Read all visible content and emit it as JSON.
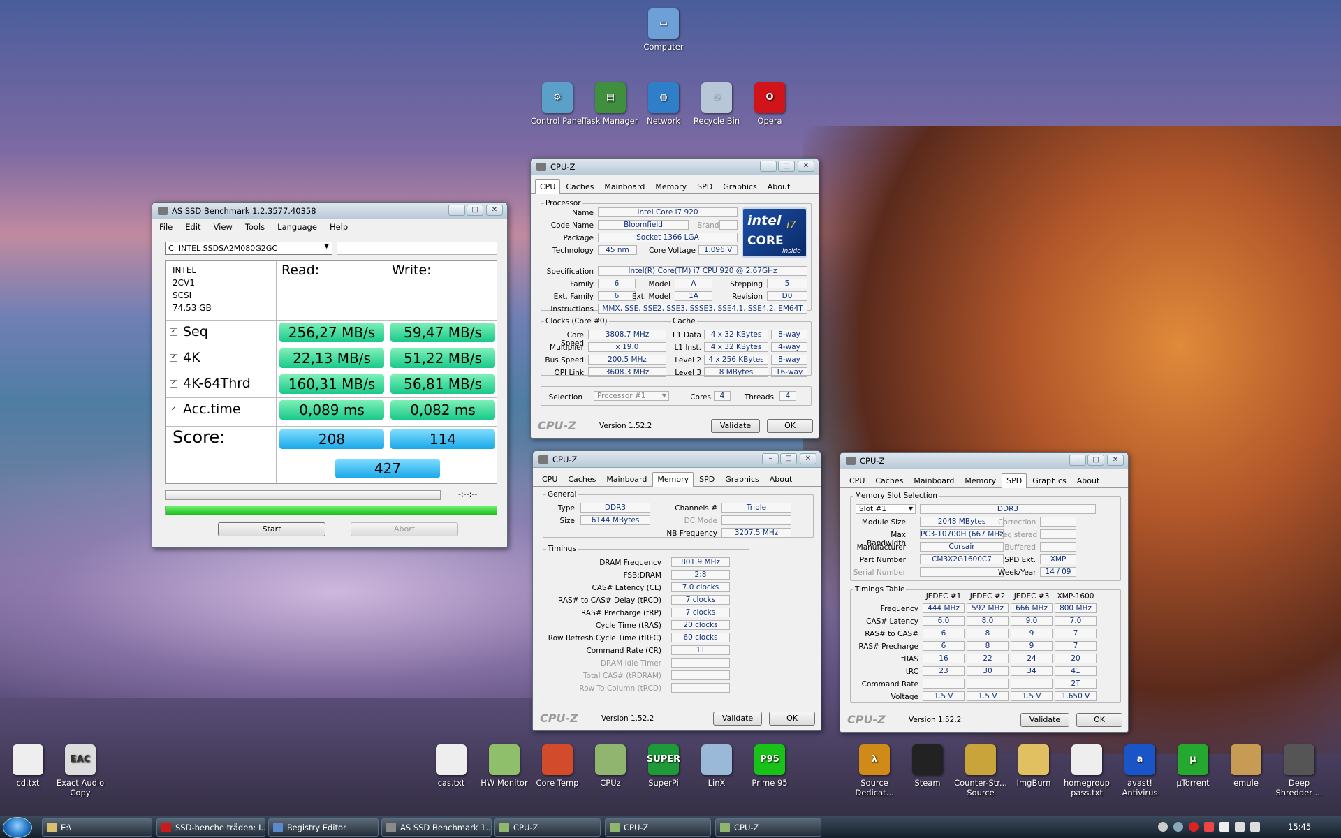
{
  "desktop": {
    "top_icons": [
      {
        "label": "Computer",
        "icon": "computer-icon"
      },
      {
        "label": "Control Panel",
        "icon": "control-panel-icon"
      },
      {
        "label": "Task Manager",
        "icon": "task-manager-icon"
      },
      {
        "label": "Network",
        "icon": "network-icon"
      },
      {
        "label": "Recycle Bin",
        "icon": "recycle-bin-icon"
      },
      {
        "label": "Opera",
        "icon": "opera-icon"
      }
    ],
    "bottom_icons": [
      {
        "label": "cd.txt",
        "color": "#eeeeee",
        "glyph": ""
      },
      {
        "label": "Exact Audio Copy",
        "color": "#dddddd",
        "glyph": "EAC"
      },
      {
        "label": "cas.txt",
        "color": "#eeeeee",
        "glyph": ""
      },
      {
        "label": "HW Monitor",
        "color": "#8fbf6a",
        "glyph": ""
      },
      {
        "label": "Core Temp",
        "color": "#d24c2b",
        "glyph": ""
      },
      {
        "label": "CPUz",
        "color": "#8fb56f",
        "glyph": ""
      },
      {
        "label": "SuperPi",
        "color": "#1f9a3a",
        "glyph": "SUPER"
      },
      {
        "label": "LinX",
        "color": "#9ab8d8",
        "glyph": ""
      },
      {
        "label": "Prime 95",
        "color": "#19c219",
        "glyph": "P95"
      },
      {
        "label": "Source Dedicat...",
        "color": "#d08a18",
        "glyph": "λ"
      },
      {
        "label": "Steam",
        "color": "#222222",
        "glyph": ""
      },
      {
        "label": "Counter-Str... Source",
        "color": "#c8a43a",
        "glyph": ""
      },
      {
        "label": "ImgBurn",
        "color": "#e0c060",
        "glyph": ""
      },
      {
        "label": "homegroup pass.txt",
        "color": "#eeeeee",
        "glyph": ""
      },
      {
        "label": "avast! Antivirus",
        "color": "#1a55c8",
        "glyph": "a"
      },
      {
        "label": "µTorrent",
        "color": "#24a830",
        "glyph": "µ"
      },
      {
        "label": "emule",
        "color": "#c89b55",
        "glyph": ""
      },
      {
        "label": "Deep Shredder ...",
        "color": "#555555",
        "glyph": ""
      }
    ]
  },
  "asssd": {
    "title": "AS SSD Benchmark 1.2.3577.40358",
    "menu": [
      "File",
      "Edit",
      "View",
      "Tools",
      "Language",
      "Help"
    ],
    "drive_select": "C: INTEL SSDSA2M080G2GC",
    "info": [
      "INTEL",
      "2CV1",
      "SCSI",
      "74,53 GB"
    ],
    "read_header": "Read:",
    "write_header": "Write:",
    "rows": [
      {
        "label": "Seq",
        "read": "256,27 MB/s",
        "write": "59,47 MB/s"
      },
      {
        "label": "4K",
        "read": "22,13 MB/s",
        "write": "51,22 MB/s"
      },
      {
        "label": "4K-64Thrd",
        "read": "160,31 MB/s",
        "write": "56,81 MB/s"
      },
      {
        "label": "Acc.time",
        "read": "0,089 ms",
        "write": "0,082 ms"
      }
    ],
    "score_label": "Score:",
    "score_read": "208",
    "score_write": "114",
    "score_total": "427",
    "progress_time": "-:--:--",
    "progress_fraction": 1.0,
    "start_label": "Start",
    "abort_label": "Abort"
  },
  "cpuz_common": {
    "title": "CPU-Z",
    "tabs": [
      "CPU",
      "Caches",
      "Mainboard",
      "Memory",
      "SPD",
      "Graphics",
      "About"
    ],
    "logo": "CPU-Z",
    "version": "Version 1.52.2",
    "validate": "Validate",
    "ok": "OK"
  },
  "cpu": {
    "processor_legend": "Processor",
    "name_l": "Name",
    "name": "Intel Core i7 920",
    "codename_l": "Code Name",
    "codename": "Bloomfield",
    "brandid_l": "Brand ID",
    "package_l": "Package",
    "package": "Socket 1366 LGA",
    "tech_l": "Technology",
    "tech": "45 nm",
    "voltage_l": "Core Voltage",
    "voltage": "1.096 V",
    "spec_l": "Specification",
    "spec": "Intel(R) Core(TM) i7 CPU        920  @ 2.67GHz",
    "family_l": "Family",
    "family": "6",
    "model_l": "Model",
    "model": "A",
    "stepping_l": "Stepping",
    "stepping": "5",
    "extfamily_l": "Ext. Family",
    "extfamily": "6",
    "extmodel_l": "Ext. Model",
    "extmodel": "1A",
    "revision_l": "Revision",
    "revision": "D0",
    "instr_l": "Instructions",
    "instr": "MMX, SSE, SSE2, SSE3, SSSE3, SSE4.1, SSE4.2, EM64T",
    "clocks_legend": "Clocks (Core #0)",
    "corespeed_l": "Core Speed",
    "corespeed": "3808.7 MHz",
    "mult_l": "Multiplier",
    "mult": "x 19.0",
    "bus_l": "Bus Speed",
    "bus": "200.5 MHz",
    "qpi_l": "QPI Link",
    "qpi": "3608.3 MHz",
    "cache_legend": "Cache",
    "l1d_l": "L1 Data",
    "l1d": "4 x 32 KBytes",
    "l1d_w": "8-way",
    "l1i_l": "L1 Inst.",
    "l1i": "4 x 32 KBytes",
    "l1i_w": "4-way",
    "l2_l": "Level 2",
    "l2": "4 x 256 KBytes",
    "l2_w": "8-way",
    "l3_l": "Level 3",
    "l3": "8 MBytes",
    "l3_w": "16-way",
    "sel_l": "Selection",
    "sel": "Processor #1",
    "cores_l": "Cores",
    "cores": "4",
    "threads_l": "Threads",
    "threads": "4",
    "logo_brand": "intel",
    "logo_core": "CORE",
    "logo_i7": "i7",
    "logo_inside": "inside"
  },
  "mem": {
    "general": "General",
    "type_l": "Type",
    "type": "DDR3",
    "size_l": "Size",
    "size": "6144 MBytes",
    "chan_l": "Channels #",
    "chan": "Triple",
    "dc_l": "DC Mode",
    "nb_l": "NB Frequency",
    "nb": "3207.5 MHz",
    "timings": "Timings",
    "rows": [
      {
        "l": "DRAM Frequency",
        "v": "801.9 MHz"
      },
      {
        "l": "FSB:DRAM",
        "v": "2:8"
      },
      {
        "l": "CAS# Latency (CL)",
        "v": "7.0 clocks"
      },
      {
        "l": "RAS# to CAS# Delay (tRCD)",
        "v": "7 clocks"
      },
      {
        "l": "RAS# Precharge (tRP)",
        "v": "7 clocks"
      },
      {
        "l": "Cycle Time (tRAS)",
        "v": "20 clocks"
      },
      {
        "l": "Row Refresh Cycle Time (tRFC)",
        "v": "60 clocks"
      },
      {
        "l": "Command Rate (CR)",
        "v": "1T"
      },
      {
        "l": "DRAM Idle Timer",
        "v": ""
      },
      {
        "l": "Total CAS# (tRDRAM)",
        "v": ""
      },
      {
        "l": "Row To Column (tRCD)",
        "v": ""
      }
    ]
  },
  "spd": {
    "slot_legend": "Memory Slot Selection",
    "slot": "Slot #1",
    "slot_type": "DDR3",
    "modsize_l": "Module Size",
    "modsize": "2048 MBytes",
    "maxbw_l": "Max Bandwidth",
    "maxbw": "PC3-10700H (667 MHz)",
    "manuf_l": "Manufacturer",
    "manuf": "Corsair",
    "part_l": "Part Number",
    "part": "CM3X2G1600C7",
    "serial_l": "Serial Number",
    "corr_l": "Correction",
    "reg_l": "Registered",
    "buf_l": "Buffered",
    "spdext_l": "SPD Ext.",
    "spdext": "XMP",
    "week_l": "Week/Year",
    "week": "14 / 09",
    "table_legend": "Timings Table",
    "cols": [
      "JEDEC #1",
      "JEDEC #2",
      "JEDEC #3",
      "XMP-1600"
    ],
    "rows": [
      {
        "l": "Frequency",
        "v": [
          "444 MHz",
          "592 MHz",
          "666 MHz",
          "800 MHz"
        ]
      },
      {
        "l": "CAS# Latency",
        "v": [
          "6.0",
          "8.0",
          "9.0",
          "7.0"
        ]
      },
      {
        "l": "RAS# to CAS#",
        "v": [
          "6",
          "8",
          "9",
          "7"
        ]
      },
      {
        "l": "RAS# Precharge",
        "v": [
          "6",
          "8",
          "9",
          "7"
        ]
      },
      {
        "l": "tRAS",
        "v": [
          "16",
          "22",
          "24",
          "20"
        ]
      },
      {
        "l": "tRC",
        "v": [
          "23",
          "30",
          "34",
          "41"
        ]
      },
      {
        "l": "Command Rate",
        "v": [
          "",
          "",
          "",
          "2T"
        ]
      },
      {
        "l": "Voltage",
        "v": [
          "1.5 V",
          "1.5 V",
          "1.5 V",
          "1.650 V"
        ]
      }
    ]
  },
  "taskbar": {
    "items": [
      {
        "label": "E:\\",
        "color": "#d8c070"
      },
      {
        "label": "SSD-benche tråden: I...",
        "color": "#cc1a1a"
      },
      {
        "label": "Registry Editor",
        "color": "#5a8acb"
      },
      {
        "label": "AS SSD Benchmark 1....",
        "color": "#8a8a8a"
      },
      {
        "label": "CPU-Z",
        "color": "#8fb56f"
      },
      {
        "label": "CPU-Z",
        "color": "#8fb56f"
      },
      {
        "label": "CPU-Z",
        "color": "#8fb56f"
      }
    ],
    "clock": "15:45"
  }
}
